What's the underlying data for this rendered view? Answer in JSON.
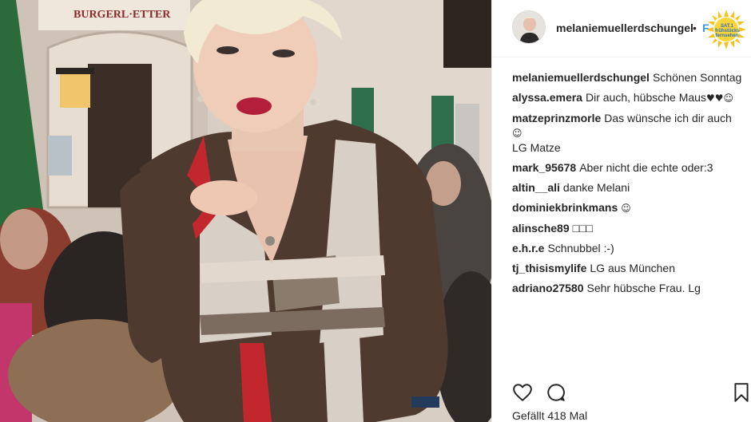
{
  "post": {
    "username": "melaniemuellerdschungel",
    "header_separator": "•",
    "follow_label": "F",
    "overlay_logo_text": "SAT.1 frühstücks fernsehen"
  },
  "comments": [
    {
      "user": "melaniemuellerdschungel",
      "text": "Schönen Sonntag",
      "emoji": ""
    },
    {
      "user": "alyssa.emera",
      "text": "Dir auch, hübsche Maus",
      "emoji": "♥♥☺"
    },
    {
      "user": "matzeprinzmorle",
      "text": "Das wünsche ich dir auch",
      "emoji": "☺",
      "text2": "LG Matze"
    },
    {
      "user": "mark_95678",
      "text": "Aber nicht die echte oder:3",
      "emoji": ""
    },
    {
      "user": "altin__ali",
      "text": "danke Melani",
      "emoji": ""
    },
    {
      "user": "dominiekbrinkmans",
      "text": "",
      "emoji": "☺"
    },
    {
      "user": "alinsche89",
      "text": "□□□",
      "emoji": ""
    },
    {
      "user": "e.h.r.e",
      "text": "Schnubbel :-)",
      "emoji": ""
    },
    {
      "user": "tj_thisismylife",
      "text": "LG aus München",
      "emoji": ""
    },
    {
      "user": "adriano27580",
      "text": "Sehr hübsche Frau. Lg",
      "emoji": ""
    }
  ],
  "actions": {
    "icons": [
      "heart-outline",
      "speech-bubble",
      "bookmark-outline"
    ]
  },
  "likes_text": "Gefällt 418 Mal",
  "colors": {
    "text": "#262626",
    "link_blue": "#3897f0",
    "sweater_brown": "#4e3a2e",
    "plaid_red": "#c2272d",
    "lips": "#b31f3a",
    "hair": "#f2ead2"
  }
}
